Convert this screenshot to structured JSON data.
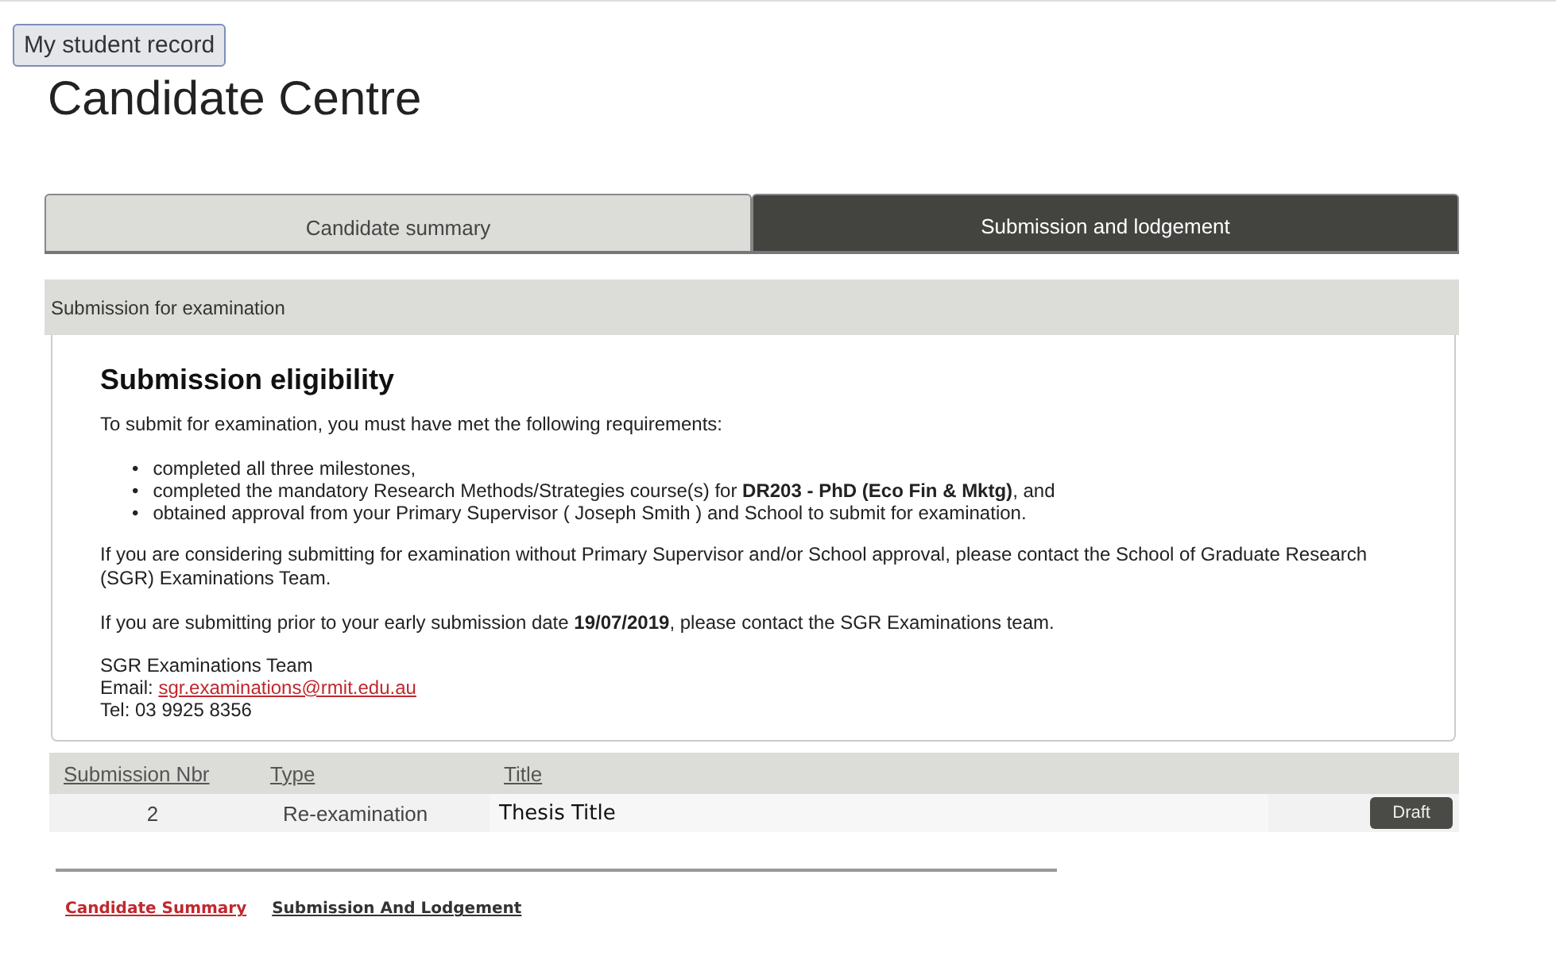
{
  "header": {
    "record_button": "My student record",
    "title": "Candidate Centre"
  },
  "tabs": [
    {
      "label": "Candidate summary",
      "selected": false
    },
    {
      "label": "Submission and lodgement",
      "selected": true
    }
  ],
  "section": {
    "title": "Submission for examination"
  },
  "eligibility": {
    "heading": "Submission eligibility",
    "intro": "To submit for examination, you must have met the following requirements:",
    "requirements": [
      {
        "marker": "•",
        "text": "completed all three milestones,"
      },
      {
        "marker": "•",
        "text": "completed the mandatory Research Methods/Strategies course(s) for **DR203 - PhD (Eco Fin & Mktg)**, and"
      },
      {
        "marker": "•",
        "text": "obtained approval from your Primary Supervisor ( Joseph Smith ) and School to submit for examination."
      }
    ],
    "paragraphs": [
      "If you are considering submitting for examination without Primary Supervisor and/or School approval, please contact the School of Graduate Research (SGR) Examinations Team.",
      "If you are submitting prior to your early submission date **19/07/2019**, please contact the SGR Examinations team."
    ],
    "contact": {
      "team": "SGR Examinations Team",
      "email_label": "Email:",
      "email": "sgr.examinations@rmit.edu.au",
      "tel": "Tel: 03 9925 8356"
    }
  },
  "table": {
    "columns": [
      "Submission Nbr",
      "Type",
      "Title"
    ],
    "rows": [
      {
        "number": "2",
        "type": "Re-examination",
        "title": "Thesis Title",
        "status": "Draft"
      }
    ]
  },
  "footer_links": [
    {
      "label": "Candidate Summary",
      "selected": true
    },
    {
      "label": "Submission And Lodgement",
      "selected": false
    }
  ]
}
